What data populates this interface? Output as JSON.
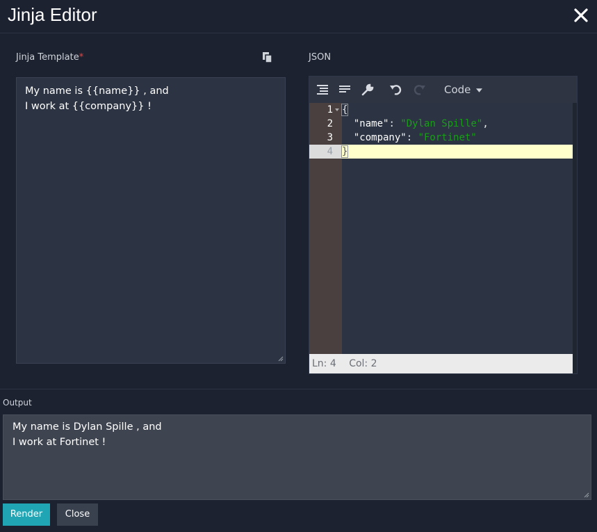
{
  "header": {
    "title": "Jinja Editor"
  },
  "template": {
    "label": "Jinja Template",
    "required_mark": "*",
    "lines": [
      "My name is {{name}} , and",
      "I work at {{company}} !"
    ]
  },
  "json_editor": {
    "label": "JSON",
    "mode_label": "Code",
    "line_numbers": [
      "1",
      "2",
      "3",
      "4"
    ],
    "code": {
      "open_brace": "{",
      "line2_key": "\"name\"",
      "line2_value": "\"Dylan Spille\"",
      "line3_key": "\"company\"",
      "line3_value": "\"Fortinet\"",
      "close_brace": "}"
    },
    "status": {
      "ln": "Ln: 4",
      "col": "Col: 2"
    }
  },
  "output": {
    "label": "Output",
    "lines": [
      "My name is Dylan Spille , and",
      "I work at Fortinet !"
    ]
  },
  "buttons": {
    "render": "Render",
    "close": "Close"
  }
}
